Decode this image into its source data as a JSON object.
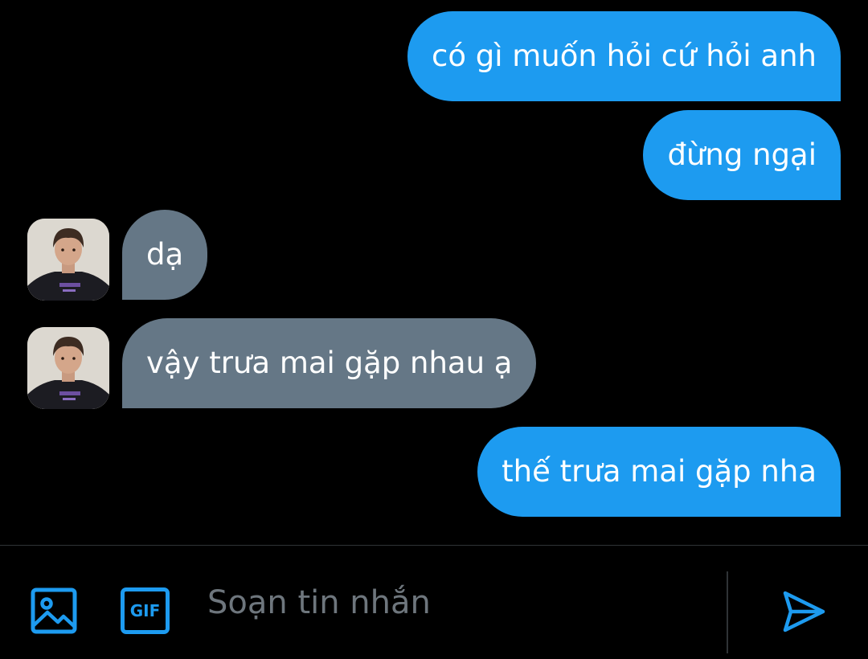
{
  "conversation": {
    "messages": [
      {
        "direction": "outgoing",
        "text": "có gì muốn hỏi cứ hỏi anh"
      },
      {
        "direction": "outgoing",
        "text": "đừng ngại"
      },
      {
        "direction": "incoming",
        "text": "dạ"
      },
      {
        "direction": "incoming",
        "text": "vậy trưa mai gặp nhau ạ"
      },
      {
        "direction": "outgoing",
        "text": "thế trưa mai gặp nha"
      }
    ]
  },
  "composer": {
    "placeholder": "Soạn tin nhắn",
    "value": "",
    "gif_label": "GIF",
    "media_icon": "image-icon",
    "send_icon": "send-icon"
  },
  "colors": {
    "background": "#000000",
    "outgoing_bubble": "#1d9bf0",
    "incoming_bubble": "#657786",
    "accent": "#1d9bf0",
    "placeholder": "#6e767d"
  }
}
